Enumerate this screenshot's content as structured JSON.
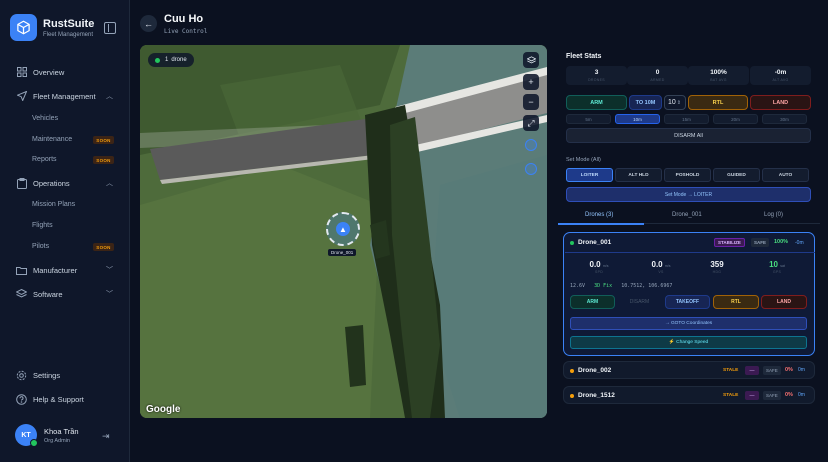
{
  "app": {
    "name": "RustSuite",
    "subtitle": "Fleet Management"
  },
  "sidebar": {
    "overview": "Overview",
    "fleet": "Fleet Management",
    "fleet_items": [
      {
        "label": "Vehicles",
        "soon": ""
      },
      {
        "label": "Maintenance",
        "soon": "SOON"
      },
      {
        "label": "Reports",
        "soon": "SOON"
      }
    ],
    "operations": "Operations",
    "operations_items": [
      {
        "label": "Mission Plans",
        "soon": ""
      },
      {
        "label": "Flights",
        "soon": ""
      },
      {
        "label": "Pilots",
        "soon": "SOON"
      }
    ],
    "manufacturer": "Manufacturer",
    "software": "Software",
    "settings": "Settings",
    "help": "Help & Support"
  },
  "user": {
    "initials": "KT",
    "name": "Khoa Trần",
    "role": "Org Admin"
  },
  "header": {
    "title": "Cuu Ho",
    "subtitle": "Live Control"
  },
  "map": {
    "drone_count": "1",
    "drone_count_label": "drone",
    "marker_label": "Drone_001",
    "attribution": "Google"
  },
  "fleet_stats": {
    "title": "Fleet Stats",
    "stats": [
      {
        "value": "3",
        "label": "DRONES"
      },
      {
        "value": "0",
        "label": "ARMED"
      },
      {
        "value": "100%",
        "label": "BAT AVG"
      },
      {
        "value": "-0m",
        "label": "ALT AVG"
      }
    ],
    "arm": "ARM",
    "to_alt": "TO 10M",
    "alt_value": "10",
    "rtl": "RTL",
    "land": "LAND",
    "alt_options": [
      "5m",
      "10m",
      "15m",
      "20m",
      "30m"
    ],
    "alt_selected": "10m",
    "disarm_all": "DISARM All",
    "mode_title": "Set Mode (All)",
    "modes": [
      "LOITER",
      "ALT HLD",
      "POSHOLD",
      "GUIDED",
      "AUTO"
    ],
    "mode_selected": "LOITER",
    "set_mode": "Set Mode → LOITER"
  },
  "tabs": [
    "Drones (3)",
    "Drone_001",
    "Log (0)"
  ],
  "active_drone": {
    "name": "Drone_001",
    "mode": "STABILIZE",
    "safe": "SAFE",
    "battery": "100%",
    "alt": "-0m",
    "telemetry": [
      {
        "value": "0.0",
        "unit": "m/s",
        "label": "SPD"
      },
      {
        "value": "0.0",
        "unit": "m/s",
        "label": "VS"
      },
      {
        "value": "359",
        "unit": "",
        "label": "HDG"
      },
      {
        "value": "10",
        "unit": "sat",
        "label": "GPS"
      }
    ],
    "voltage": "12.6V",
    "fix": "3D Fix",
    "coords": "10.7512, 106.6967",
    "buttons": {
      "arm": "ARM",
      "disarm": "DISARM",
      "takeoff": "TAKEOFF",
      "rtl": "RTL",
      "land": "LAND"
    },
    "goto": "→ GOTO Coordinates",
    "speed": "⚡ Change Speed"
  },
  "other_drones": [
    {
      "name": "Drone_002",
      "status": "STALE",
      "mode": "—",
      "safe": "SAFE",
      "battery": "0%",
      "alt": "0m"
    },
    {
      "name": "Drone_1512",
      "status": "STALE",
      "mode": "—",
      "safe": "SAFE",
      "battery": "0%",
      "alt": "0m"
    }
  ],
  "colors": {
    "accent": "#3b82f6",
    "sidebar_bg": "#0f172a",
    "page_bg": "#0b1120",
    "online": "#22c55e",
    "stale": "#f59e0b"
  }
}
